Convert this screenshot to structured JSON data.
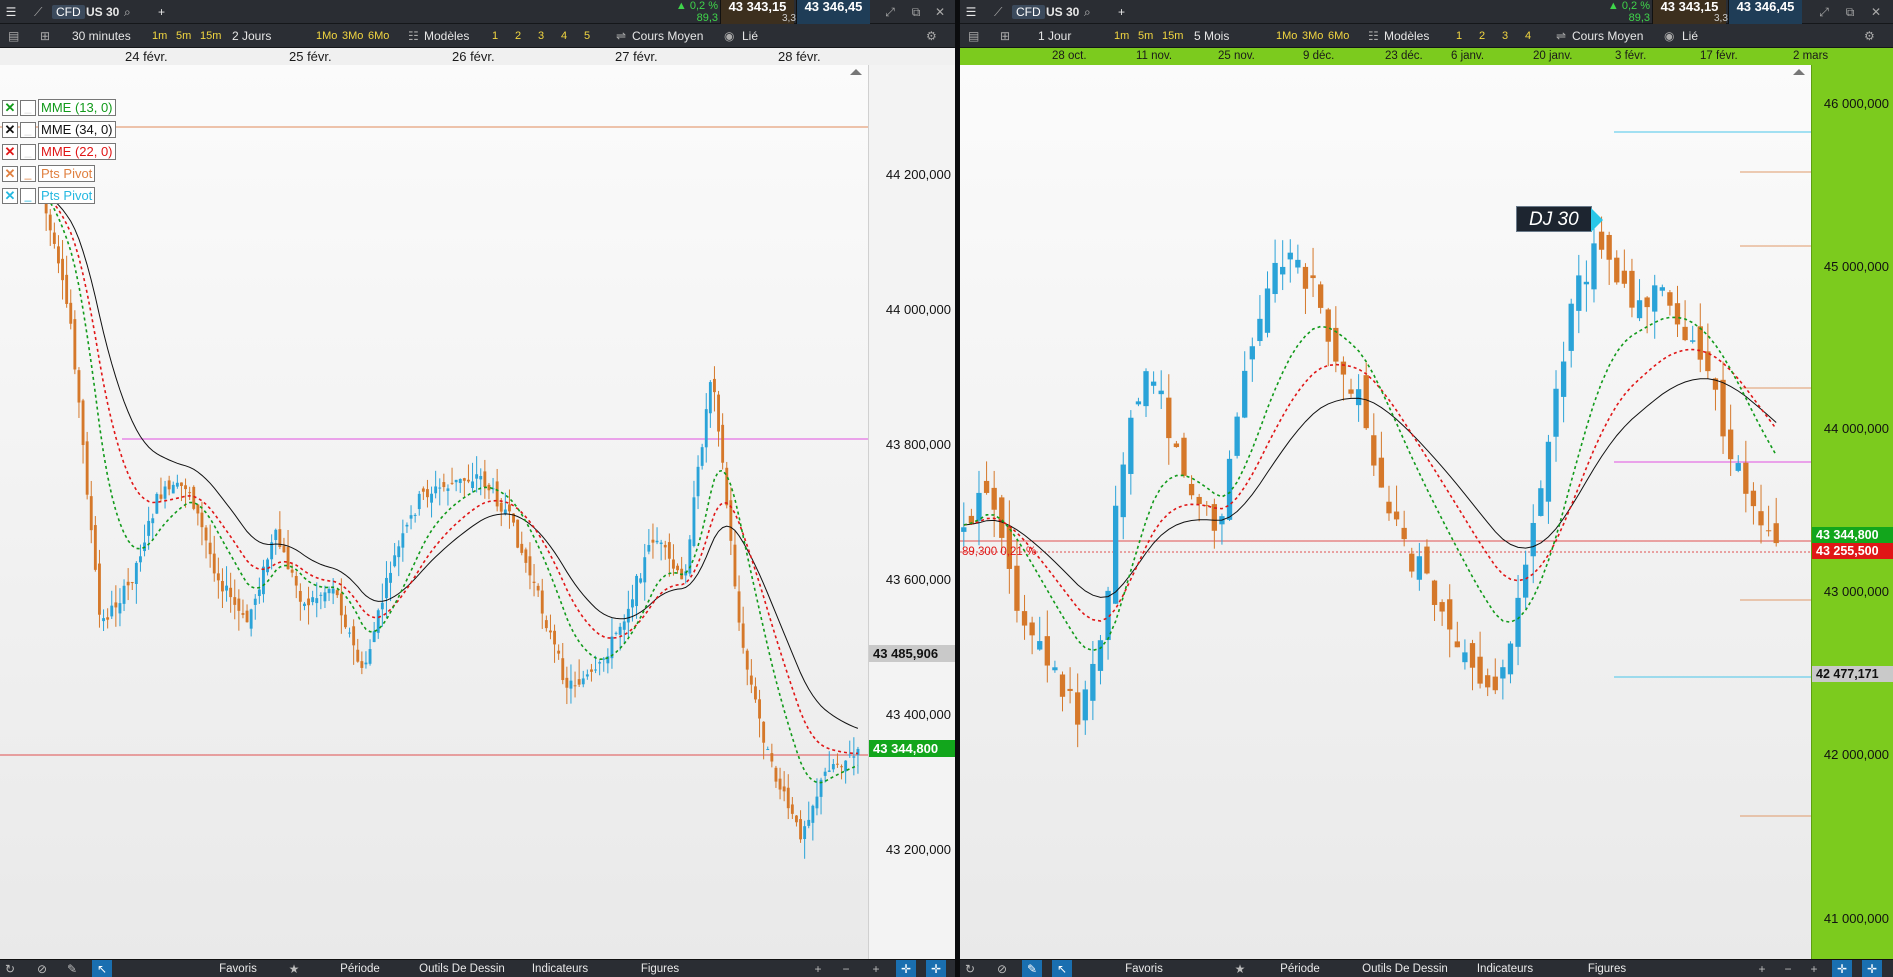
{
  "left": {
    "instrument_type": "CFD",
    "symbol": "US 30",
    "change_pct": "▲ 0,2 %",
    "change_pts": "89,3",
    "bid": "43 343,15",
    "ask": "43 346,45",
    "spread": "3,30",
    "toolbar": {
      "interval": "30 minutes",
      "periods": [
        "1m",
        "5m",
        "15m"
      ],
      "range": "2 Jours",
      "ranges": [
        "1Mo",
        "3Mo",
        "6Mo"
      ],
      "models": "Modèles",
      "layouts": [
        "1",
        "2",
        "3",
        "4",
        "5"
      ],
      "price_type": "Cours Moyen",
      "linked": "Lié"
    },
    "dates": [
      "24 févr.",
      "25 févr.",
      "26 févr.",
      "27 févr.",
      "28 févr."
    ],
    "y_ticks": [
      "44 200,000",
      "44 000,000",
      "43 800,000",
      "43 600,000",
      "43 400,000",
      "43 200,000"
    ],
    "marker_gray": "43 485,906",
    "marker_green": "43 344,800",
    "legend": [
      {
        "label": "MME (13, 0)",
        "color": "#119a1a"
      },
      {
        "label": "MME (34, 0)",
        "color": "#111111"
      },
      {
        "label": "MME (22, 0)",
        "color": "#e01616"
      },
      {
        "label": "Pts Pivot",
        "color": "#e08040"
      },
      {
        "label": "Pts Pivot",
        "color": "#25b8e0"
      }
    ]
  },
  "right": {
    "instrument_type": "CFD",
    "symbol": "US 30",
    "change_pct": "▲ 0,2 %",
    "change_pts": "89,3",
    "bid": "43 343,15",
    "ask": "43 346,45",
    "spread": "3,30",
    "toolbar": {
      "interval": "1 Jour",
      "periods": [
        "1m",
        "5m",
        "15m"
      ],
      "range": "5 Mois",
      "ranges": [
        "1Mo",
        "3Mo",
        "6Mo"
      ],
      "models": "Modèles",
      "layouts": [
        "1",
        "2",
        "3",
        "4"
      ],
      "price_type": "Cours Moyen",
      "linked": "Lié"
    },
    "dates": [
      "28 oct.",
      "11 nov.",
      "25 nov.",
      "9 déc.",
      "23 déc.",
      "6 janv.",
      "20 janv.",
      "3 févr.",
      "17 févr.",
      "2 mars"
    ],
    "y_ticks": [
      "46 000,000",
      "45 000,000",
      "44 000,000",
      "43 000,000",
      "42 000,000",
      "41 000,000"
    ],
    "marker_green": "43 344,800",
    "marker_red": "43 255,500",
    "marker_gray": "42 477,171",
    "change_annotation": "89,300 0,21 %",
    "chart_label": "DJ 30"
  },
  "bottom": {
    "items": [
      "Favoris",
      "Période",
      "Outils De Dessin",
      "Indicateurs",
      "Figures"
    ]
  }
}
